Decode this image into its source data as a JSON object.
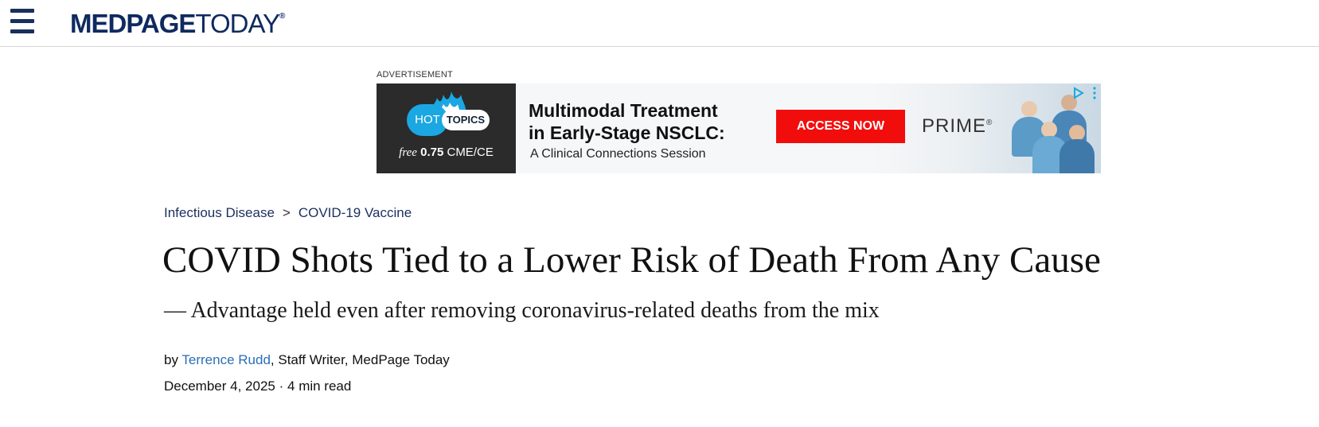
{
  "header": {
    "menu_icon": "hamburger-menu-icon",
    "logo": {
      "bold": "MEDPAGE",
      "light": "TODAY",
      "mark": "®"
    },
    "colors": {
      "brand": "#0f2a5f",
      "divider": "#d6d6d6"
    }
  },
  "advertisement": {
    "label": "ADVERTISEMENT",
    "hot_topics": {
      "left": "HOT",
      "right": "TOPICS"
    },
    "cme": {
      "prefix": "free",
      "amount": "0.75",
      "unit": "CME/CE"
    },
    "headline_line1": "Multimodal Treatment",
    "headline_line2": "in Early-Stage NSCLC:",
    "subline": "A Clinical Connections Session",
    "cta": "ACCESS NOW",
    "brand": "PRIME",
    "brand_mark": "®",
    "icons": [
      "adchoices-icon",
      "ad-menu-icon"
    ],
    "colors": {
      "cta": "#f20d0d",
      "dark_panel": "#2b2b2b",
      "bubble": "#1ba7e1"
    }
  },
  "breadcrumb": {
    "items": [
      "Infectious Disease",
      "COVID-19 Vaccine"
    ],
    "separator": ">"
  },
  "article": {
    "title": "COVID Shots Tied to a Lower Risk of Death From Any Cause",
    "subtitle": "— Advantage held even after removing coronavirus-related deaths from the mix",
    "byline_prefix": "by",
    "author": "Terrence Rudd",
    "author_role": ", Staff Writer, MedPage Today",
    "date": "December 4, 2025",
    "dot": "·",
    "read_time": "4 min read",
    "colors": {
      "author_link": "#2a6fb6",
      "breadcrumb": "#1a2f5f"
    }
  }
}
